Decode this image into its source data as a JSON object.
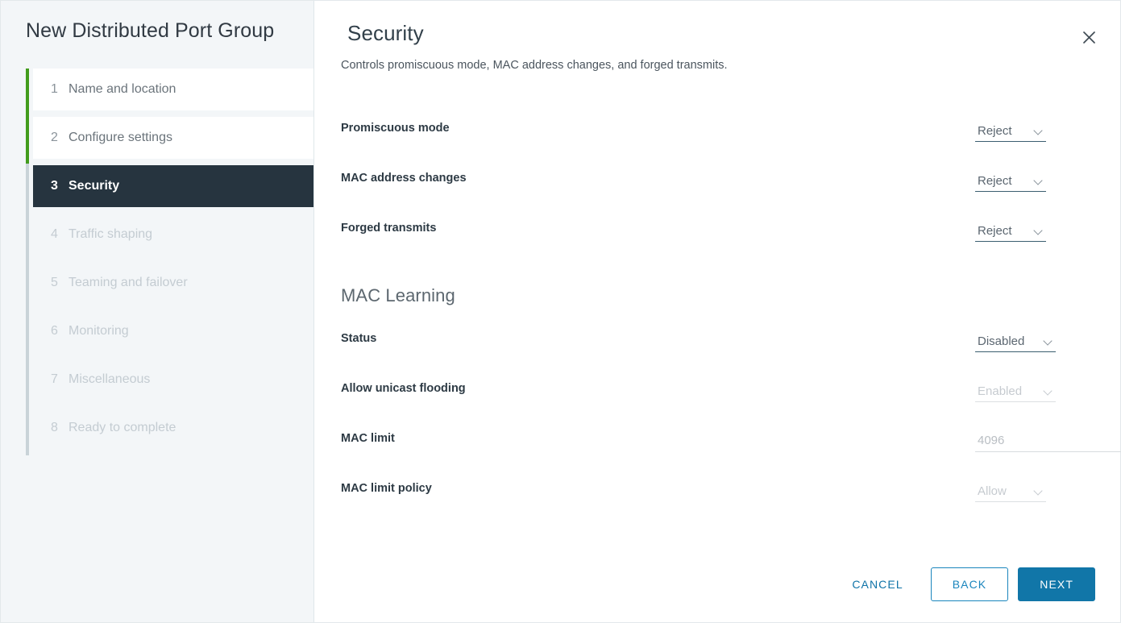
{
  "wizard": {
    "title": "New Distributed Port Group",
    "steps": [
      {
        "num": "1",
        "label": "Name and location",
        "state": "done"
      },
      {
        "num": "2",
        "label": "Configure settings",
        "state": "done"
      },
      {
        "num": "3",
        "label": "Security",
        "state": "active"
      },
      {
        "num": "4",
        "label": "Traffic shaping",
        "state": "upcoming"
      },
      {
        "num": "5",
        "label": "Teaming and failover",
        "state": "upcoming"
      },
      {
        "num": "6",
        "label": "Monitoring",
        "state": "upcoming"
      },
      {
        "num": "7",
        "label": "Miscellaneous",
        "state": "upcoming"
      },
      {
        "num": "8",
        "label": "Ready to complete",
        "state": "upcoming"
      }
    ],
    "progress_color": "#429c1d",
    "active_color": "#26343f"
  },
  "page": {
    "title": "Security",
    "subtitle": "Controls promiscuous mode, MAC address changes, and forged transmits.",
    "close_icon": "close-icon"
  },
  "security": {
    "promiscuous_mode": {
      "label": "Promiscuous mode",
      "value": "Reject"
    },
    "mac_address_changes": {
      "label": "MAC address changes",
      "value": "Reject"
    },
    "forged_transmits": {
      "label": "Forged transmits",
      "value": "Reject"
    }
  },
  "mac_learning": {
    "heading": "MAC Learning",
    "status": {
      "label": "Status",
      "value": "Disabled"
    },
    "allow_unicast_flooding": {
      "label": "Allow unicast flooding",
      "value": "Enabled"
    },
    "mac_limit": {
      "label": "MAC limit",
      "value": "4096"
    },
    "mac_limit_policy": {
      "label": "MAC limit policy",
      "value": "Allow"
    }
  },
  "footer": {
    "cancel_label": "CANCEL",
    "back_label": "BACK",
    "next_label": "NEXT",
    "primary_color": "#1176a8"
  }
}
